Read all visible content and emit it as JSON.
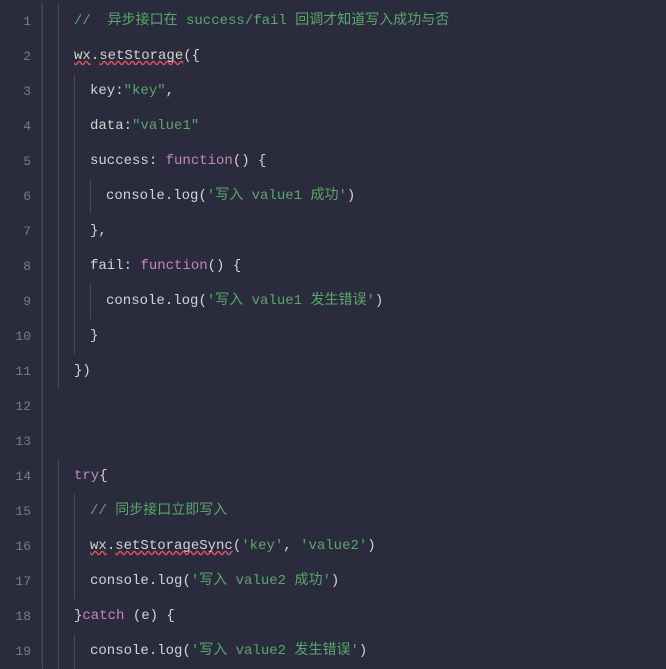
{
  "lines": {
    "l1": {
      "num": "1"
    },
    "l2": {
      "num": "2"
    },
    "l3": {
      "num": "3"
    },
    "l4": {
      "num": "4"
    },
    "l5": {
      "num": "5"
    },
    "l6": {
      "num": "6"
    },
    "l7": {
      "num": "7"
    },
    "l8": {
      "num": "8"
    },
    "l9": {
      "num": "9"
    },
    "l10": {
      "num": "10"
    },
    "l11": {
      "num": "11"
    },
    "l12": {
      "num": "12"
    },
    "l13": {
      "num": "13"
    },
    "l14": {
      "num": "14"
    },
    "l15": {
      "num": "15"
    },
    "l16": {
      "num": "16"
    },
    "l17": {
      "num": "17"
    },
    "l18": {
      "num": "18"
    },
    "l19": {
      "num": "19"
    }
  },
  "tokens": {
    "comment1": "//  异步接口在 success/fail 回调才知道写入成功与否",
    "wx1": "wx",
    "dot1": ".",
    "setStorage": "setStorage",
    "openParenBrace": "({",
    "key_prop": "key",
    "colon_str_key": ":",
    "str_key": "\"key\"",
    "comma1": ",",
    "data_prop": "data",
    "colon_data": ":",
    "str_value1": "\"value1\"",
    "success_prop": "success",
    "colon_success": ": ",
    "function_kw1": "function",
    "fn_parens1": "() {",
    "console1": "console",
    "dot_log1": ".",
    "log1": "log",
    "open_p1": "(",
    "str_write_v1_ok": "'写入 value1 成功'",
    "close_p1": ")",
    "close_brace_comma": "},",
    "fail_prop": "fail",
    "colon_fail": ": ",
    "function_kw2": "function",
    "fn_parens2": "() {",
    "console2": "console",
    "dot_log2": ".",
    "log2": "log",
    "open_p2": "(",
    "str_write_v1_err": "'写入 value1 发生错误'",
    "close_p2": ")",
    "close_brace": "}",
    "close_brace_paren": "})",
    "try_kw": "try",
    "open_brace_try": "{",
    "comment2": "// 同步接口立即写入",
    "wx2": "wx",
    "dot2": ".",
    "setStorageSync": "setStorageSync",
    "open_p3": "(",
    "str_key2": "'key'",
    "comma_space": ", ",
    "str_value2": "'value2'",
    "close_p3": ")",
    "console3": "console",
    "dot_log3": ".",
    "log3": "log",
    "open_p4": "(",
    "str_write_v2_ok": "'写入 value2 成功'",
    "close_p4": ")",
    "close_brace_catch": "}",
    "catch_kw": "catch",
    "catch_parens": " (e) {",
    "console4": "console",
    "dot_log4": ".",
    "log4": "log",
    "open_p5": "(",
    "str_write_v2_err": "'写入 value2 发生错误'",
    "close_p5": ")"
  }
}
